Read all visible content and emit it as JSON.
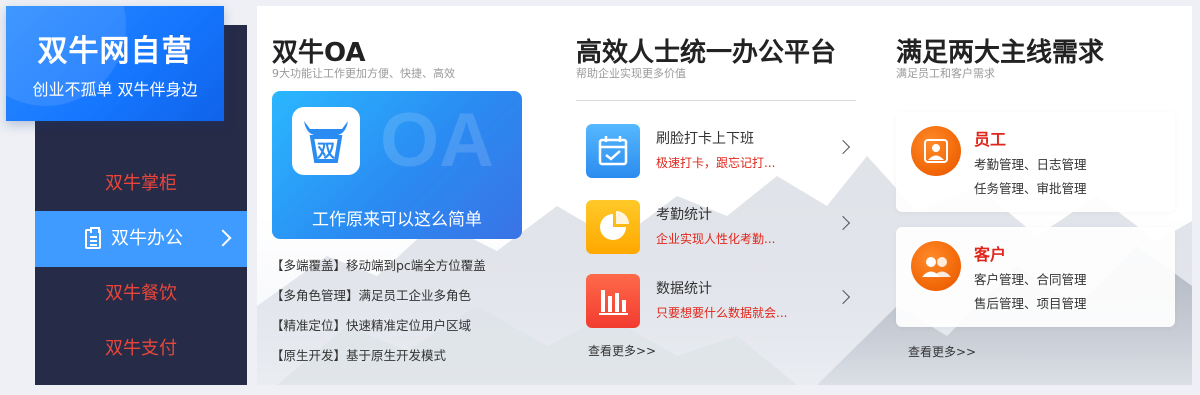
{
  "brand": {
    "title": "双牛网自营",
    "slogan": "创业不孤单  双牛伴身边"
  },
  "sidebar": {
    "items": [
      {
        "label": "双牛掌柜",
        "active": false
      },
      {
        "label": "双牛办公",
        "active": true,
        "icon": "clipboard-icon"
      },
      {
        "label": "双牛餐饮",
        "active": false
      },
      {
        "label": "双牛支付",
        "active": false
      }
    ]
  },
  "col1": {
    "title": "双牛OA",
    "subtitle": "9大功能让工作更加方便、快捷、高效",
    "card": {
      "watermark": "OA",
      "caption": "工作原来可以这么简单",
      "logo": "双"
    },
    "features": [
      "【多端覆盖】移动端到pc端全方位覆盖",
      "【多角色管理】满足员工企业多角色",
      "【精准定位】快速精准定位用户区域",
      "【原生开发】基于原生开发模式"
    ]
  },
  "col2": {
    "title": "高效人士统一办公平台",
    "subtitle": "帮助企业实现更多价值",
    "services": [
      {
        "name": "刷脸打卡上下班",
        "desc": "极速打卡，跟忘记打...",
        "icon": "calendar-check-icon",
        "color": "#3aa0f5"
      },
      {
        "name": "考勤统计",
        "desc": "企业实现人性化考勤...",
        "icon": "pie-chart-icon",
        "color": "#ffb300"
      },
      {
        "name": "数据统计",
        "desc": "只要想要什么数据就会...",
        "icon": "bar-chart-icon",
        "color": "#f4433a"
      }
    ],
    "more": "查看更多>>"
  },
  "col3": {
    "title": "满足两大主线需求",
    "subtitle": "满足员工和客户需求",
    "cards": [
      {
        "title": "员工",
        "line1": "考勤管理、日志管理",
        "line2": "任务管理、审批管理",
        "icon": "person-icon"
      },
      {
        "title": "客户",
        "line1": "客户管理、合同管理",
        "line2": "售后管理、项目管理",
        "icon": "people-icon"
      }
    ],
    "more": "查看更多>>"
  },
  "colors": {
    "accent": "#3f9bff",
    "sidebar_bg": "#262b47",
    "red": "#e0261b",
    "orange": "#f26a0a"
  }
}
